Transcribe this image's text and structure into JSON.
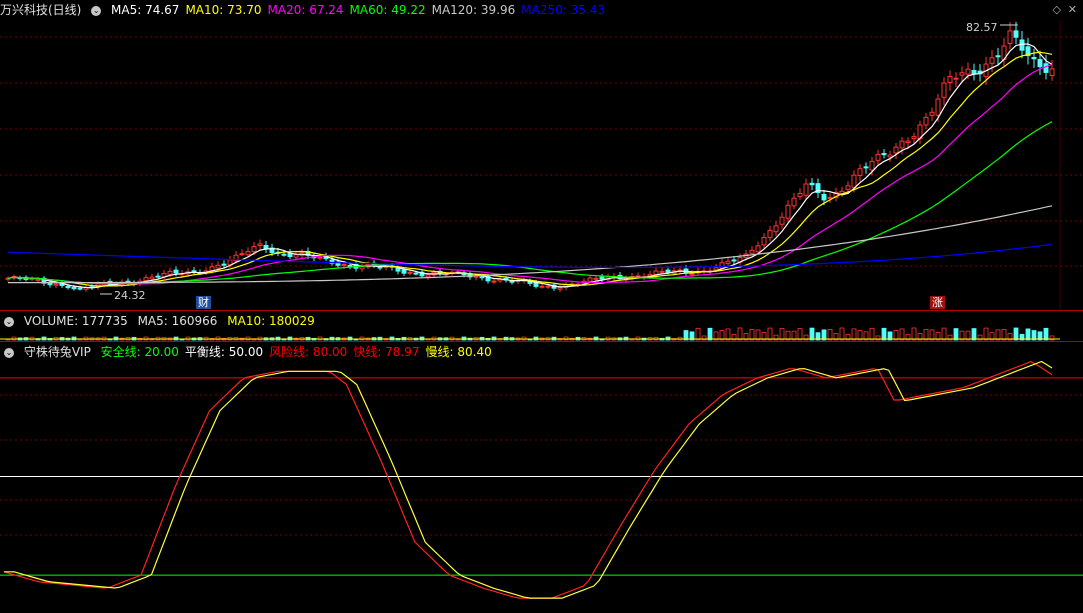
{
  "main_header": {
    "title": "万兴科技(日线)",
    "indicators": [
      {
        "label": "MA5: 74.67",
        "color": "#ffffff"
      },
      {
        "label": "MA10: 73.70",
        "color": "#ffff00"
      },
      {
        "label": "MA20: 67.24",
        "color": "#ff00ff"
      },
      {
        "label": "MA60: 49.22",
        "color": "#00ff00"
      },
      {
        "label": "MA120: 39.96",
        "color": "#c8c8c8"
      },
      {
        "label": "MA250: 35.43",
        "color": "#0000ff"
      }
    ]
  },
  "main_chart": {
    "high_label": "82.57",
    "low_label": "24.32",
    "marker_cai": "财",
    "marker_zhang": "涨"
  },
  "volume_header": {
    "volume": "VOLUME: 177735",
    "ma5": "MA5: 160966",
    "ma10": "MA10: 180029"
  },
  "indicator_header": {
    "name": "守株待兔VIP",
    "items": [
      {
        "label": "安全线: 20.00",
        "color": "#00ff00"
      },
      {
        "label": "平衡线: 50.00",
        "color": "#ffffff"
      },
      {
        "label": "风险线: 80.00",
        "color": "#ff0000"
      },
      {
        "label": "快线: 78.97",
        "color": "#ff0000"
      },
      {
        "label": "慢线: 80.40",
        "color": "#ffff00"
      }
    ]
  },
  "colors": {
    "up": "#ff3232",
    "down": "#54fcfc",
    "grid": "#7a0000",
    "background": "#000000"
  }
}
